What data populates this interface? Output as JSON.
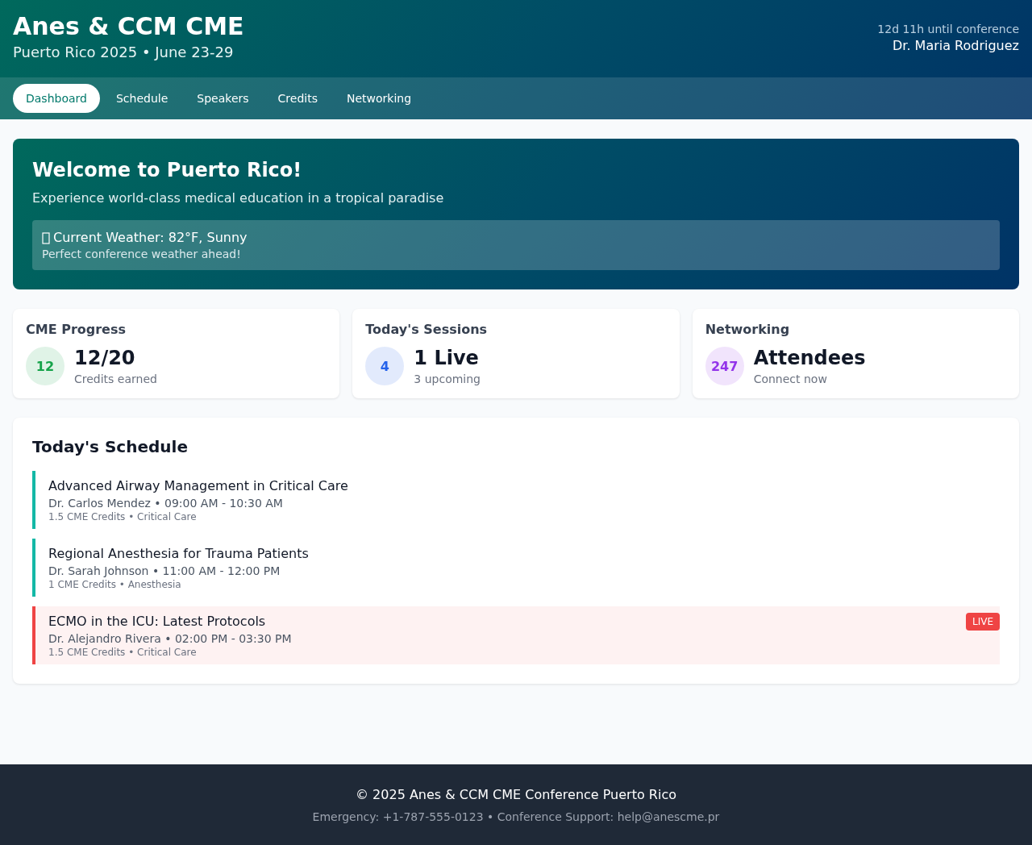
{
  "header": {
    "title": "Anes & CCM CME",
    "subtitle": "Puerto Rico 2025 • June 23-29",
    "countdown": "12d 11h until conference",
    "user": "Dr. Maria Rodriguez"
  },
  "tabs": [
    {
      "label": "Dashboard",
      "selected": true
    },
    {
      "label": "Schedule",
      "selected": false
    },
    {
      "label": "Speakers",
      "selected": false
    },
    {
      "label": "Credits",
      "selected": false
    },
    {
      "label": "Networking",
      "selected": false
    }
  ],
  "welcome": {
    "title": "Welcome to Puerto Rico!",
    "text": "Experience world-class medical education in a tropical paradise",
    "weather": "Current Weather: 82°F, Sunny",
    "weather_note": "Perfect conference weather ahead!"
  },
  "stats": [
    {
      "title": "CME Progress",
      "badge": "12",
      "value": "12/20",
      "caption": "Credits earned",
      "color": "#16a34a"
    },
    {
      "title": "Today's Sessions",
      "badge": "4",
      "value": "1 Live",
      "caption": "3 upcoming",
      "color": "#2563eb"
    },
    {
      "title": "Networking",
      "badge": "247",
      "value": "Attendees",
      "caption": "Connect now",
      "color": "#9333ea"
    }
  ],
  "schedule": {
    "title": "Today's Schedule",
    "sessions": [
      {
        "title": "Advanced Airway Management in Critical Care",
        "speaker": "Dr. Carlos Mendez • 09:00 AM - 10:30 AM",
        "details": "1.5 CME Credits • Critical Care",
        "live": false
      },
      {
        "title": "Regional Anesthesia for Trauma Patients",
        "speaker": "Dr. Sarah Johnson • 11:00 AM - 12:00 PM",
        "details": "1 CME Credits • Anesthesia",
        "live": false
      },
      {
        "title": "ECMO in the ICU: Latest Protocols",
        "speaker": "Dr. Alejandro Rivera • 02:00 PM - 03:30 PM",
        "details": "1.5 CME Credits • Critical Care",
        "live": true,
        "badge": "LIVE"
      }
    ]
  },
  "footer": {
    "copyright": "© 2025 Anes & CCM CME Conference Puerto Rico",
    "contact": "Emergency: +1-787-555-0123 • Conference Support: help@anescme.pr"
  }
}
